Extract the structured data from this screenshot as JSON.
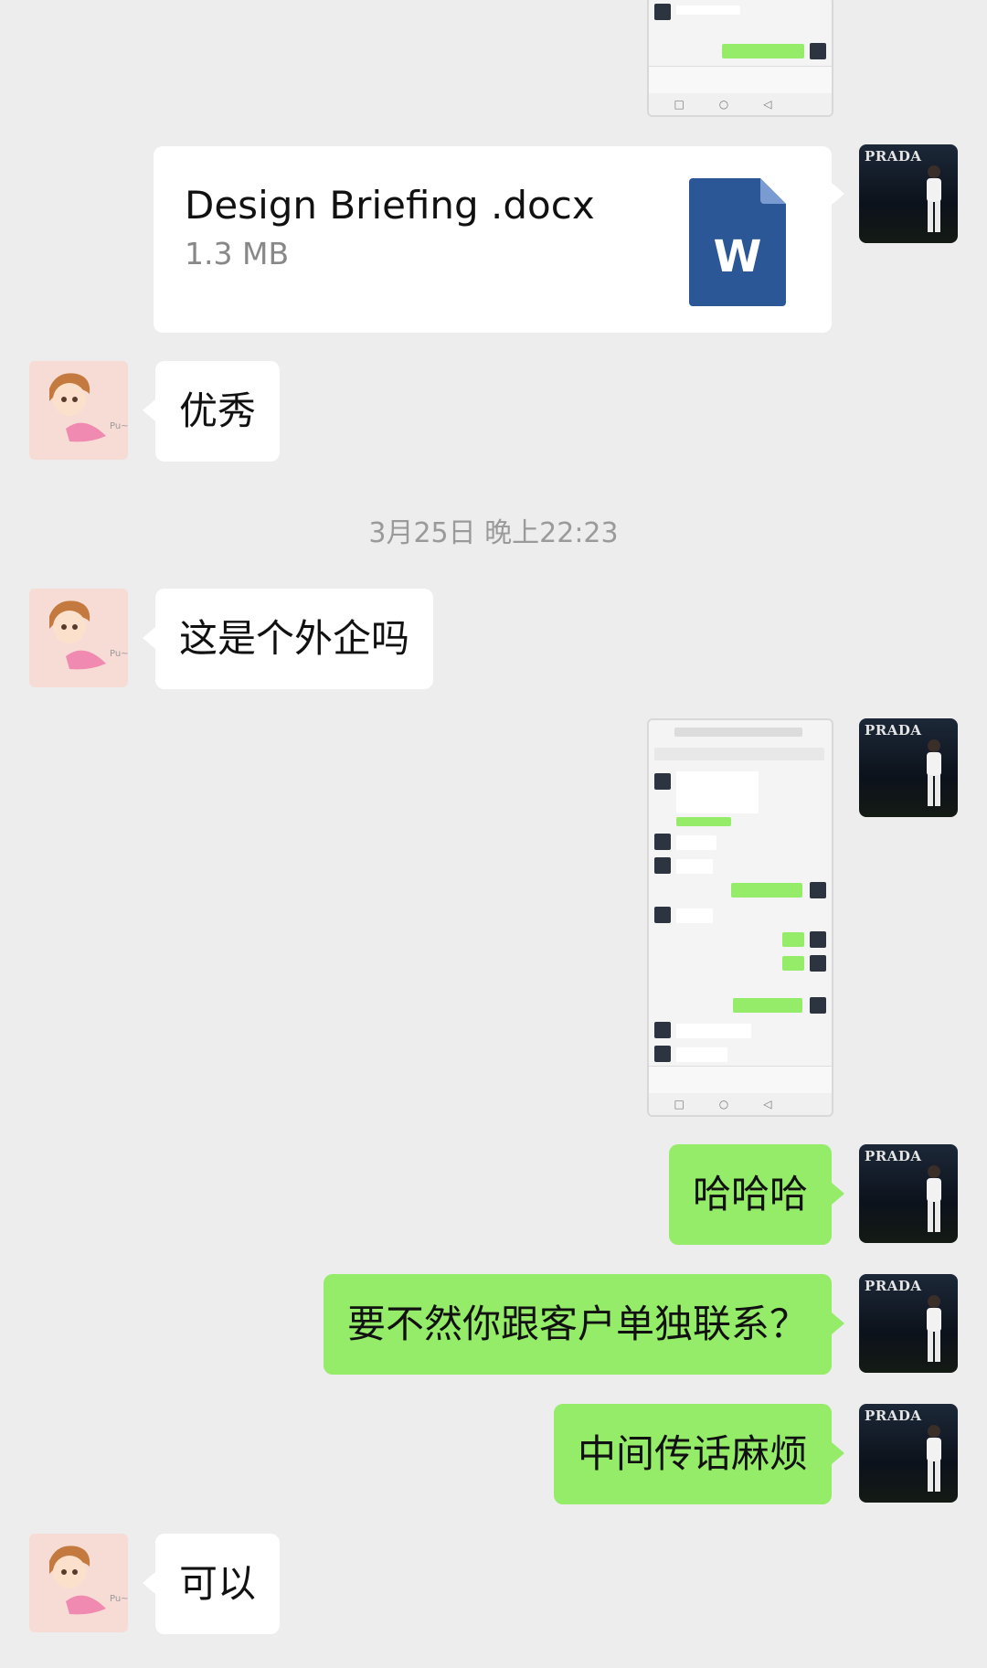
{
  "file_message": {
    "name": "Design Briefing .docx",
    "size": "1.3 MB",
    "icon": "word-doc-icon",
    "icon_letter": "W"
  },
  "messages": [
    {
      "side": "left",
      "text": "优秀"
    },
    {
      "side": "left",
      "text": "这是个外企吗"
    },
    {
      "side": "right",
      "text": "哈哈哈"
    },
    {
      "side": "right",
      "text": "要不然你跟客户单独联系？"
    },
    {
      "side": "right",
      "text": "中间传话麻烦"
    },
    {
      "side": "left",
      "text": "可以"
    }
  ],
  "timestamp": "3月25日 晚上22:23",
  "self_avatar": {
    "label": "PRADA"
  },
  "colors": {
    "background": "#ededed",
    "bubble_self": "#95ec69",
    "bubble_other": "#ffffff",
    "word_blue": "#2b5797"
  }
}
